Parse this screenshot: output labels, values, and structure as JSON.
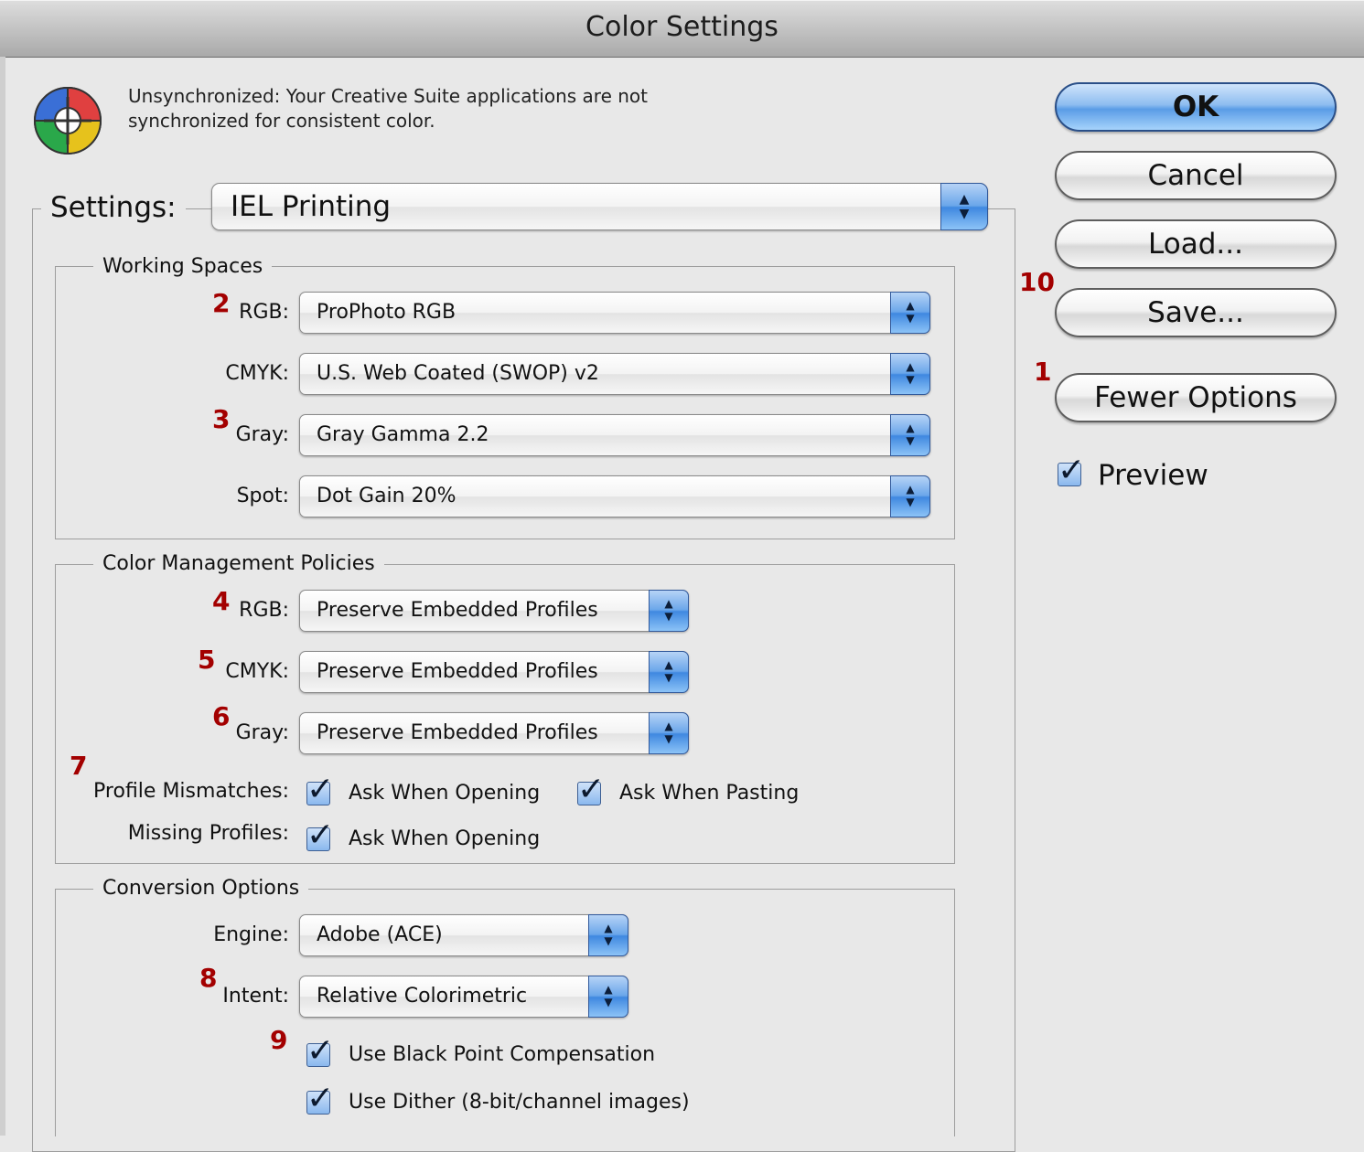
{
  "window": {
    "title": "Color Settings"
  },
  "sync": {
    "message_line1": "Unsynchronized: Your Creative Suite applications are not",
    "message_line2": "synchronized for consistent color."
  },
  "buttons": {
    "ok": "OK",
    "cancel": "Cancel",
    "load": "Load...",
    "save": "Save...",
    "fewer_options": "Fewer Options"
  },
  "preview": {
    "label": "Preview",
    "checked": true
  },
  "settings": {
    "label": "Settings:",
    "value": "IEL Printing"
  },
  "working_spaces": {
    "legend": "Working Spaces",
    "rgb_label": "RGB:",
    "rgb_value": "ProPhoto RGB",
    "cmyk_label": "CMYK:",
    "cmyk_value": "U.S. Web Coated (SWOP) v2",
    "gray_label": "Gray:",
    "gray_value": "Gray Gamma 2.2",
    "spot_label": "Spot:",
    "spot_value": "Dot Gain 20%"
  },
  "policies": {
    "legend": "Color Management Policies",
    "rgb_label": "RGB:",
    "rgb_value": "Preserve Embedded Profiles",
    "cmyk_label": "CMYK:",
    "cmyk_value": "Preserve Embedded Profiles",
    "gray_label": "Gray:",
    "gray_value": "Preserve Embedded Profiles",
    "mismatch_label": "Profile Mismatches:",
    "mismatch_opening": "Ask When Opening",
    "mismatch_pasting": "Ask When Pasting",
    "missing_label": "Missing Profiles:",
    "missing_opening": "Ask When Opening"
  },
  "conversion": {
    "legend": "Conversion Options",
    "engine_label": "Engine:",
    "engine_value": "Adobe (ACE)",
    "intent_label": "Intent:",
    "intent_value": "Relative Colorimetric",
    "bpc_label": "Use Black Point Compensation",
    "dither_label": "Use Dither (8-bit/channel images)"
  },
  "annotations": {
    "n1": "1",
    "n2": "2",
    "n3": "3",
    "n4": "4",
    "n5": "5",
    "n6": "6",
    "n7": "7",
    "n8": "8",
    "n9": "9",
    "n10": "10"
  },
  "icons": {
    "app_icon": "color-wheel-icon",
    "popup_arrows": "up-down-arrows-icon",
    "check": "checkmark-icon"
  },
  "colors": {
    "annotation_red": "#a30000",
    "aqua_blue": "#5a9ce6"
  }
}
